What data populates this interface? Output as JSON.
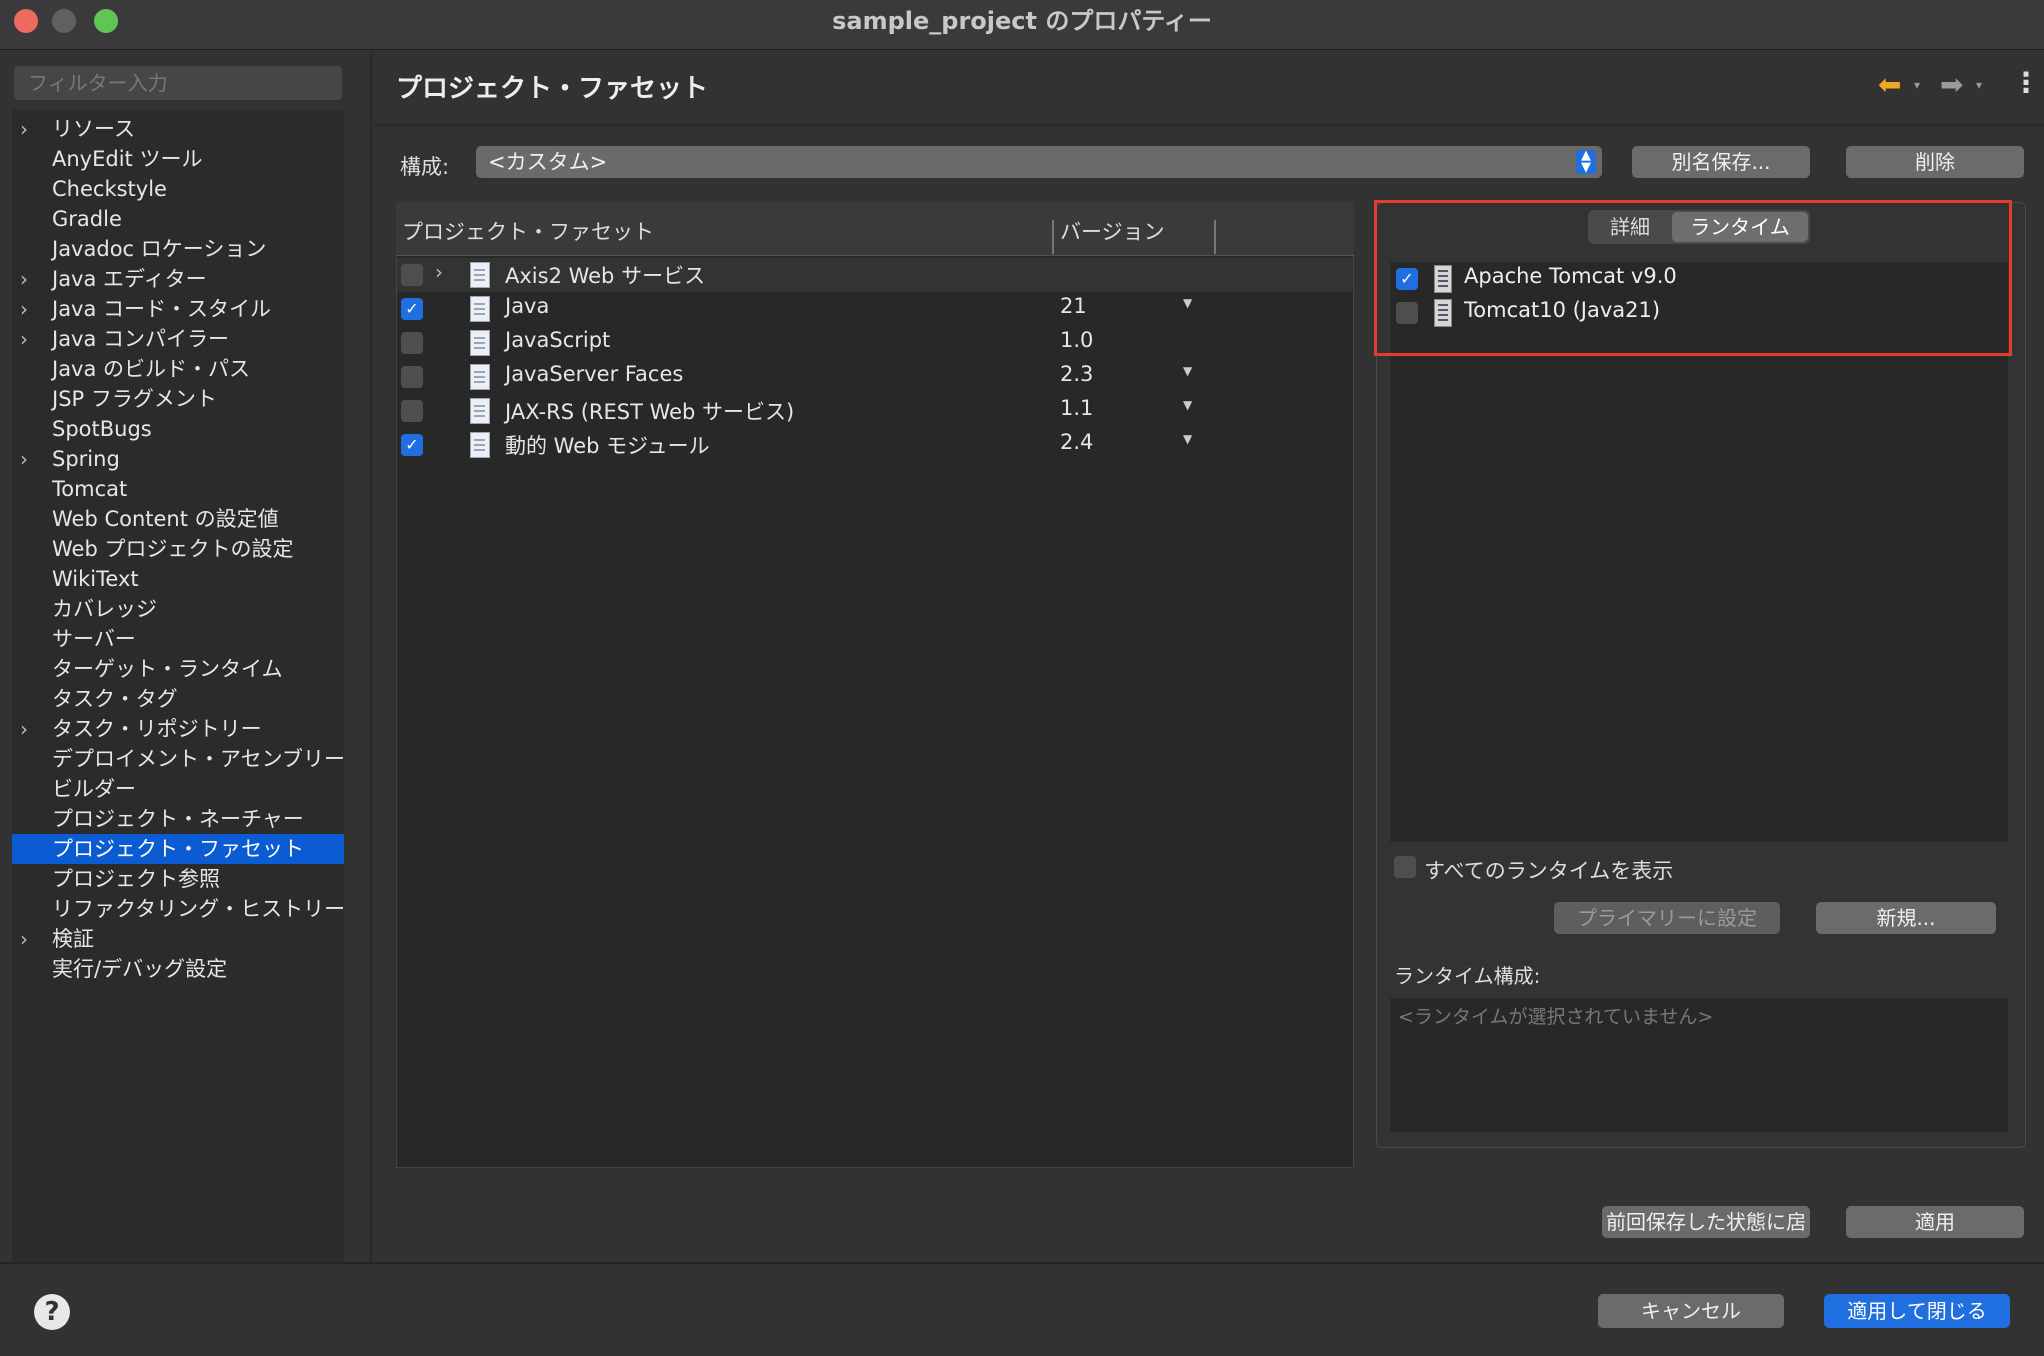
{
  "window": {
    "title": "sample_project のプロパティー"
  },
  "filter": {
    "placeholder": "フィルター入力"
  },
  "sidebar": {
    "items": [
      {
        "label": "リソース",
        "expandable": true
      },
      {
        "label": "AnyEdit ツール",
        "expandable": false
      },
      {
        "label": "Checkstyle",
        "expandable": false
      },
      {
        "label": "Gradle",
        "expandable": false
      },
      {
        "label": "Javadoc ロケーション",
        "expandable": false
      },
      {
        "label": "Java エディター",
        "expandable": true
      },
      {
        "label": "Java コード・スタイル",
        "expandable": true
      },
      {
        "label": "Java コンパイラー",
        "expandable": true
      },
      {
        "label": "Java のビルド・パス",
        "expandable": false
      },
      {
        "label": "JSP フラグメント",
        "expandable": false
      },
      {
        "label": "SpotBugs",
        "expandable": false
      },
      {
        "label": "Spring",
        "expandable": true
      },
      {
        "label": "Tomcat",
        "expandable": false
      },
      {
        "label": "Web Content の設定値",
        "expandable": false
      },
      {
        "label": "Web プロジェクトの設定",
        "expandable": false
      },
      {
        "label": "WikiText",
        "expandable": false
      },
      {
        "label": "カバレッジ",
        "expandable": false
      },
      {
        "label": "サーバー",
        "expandable": false
      },
      {
        "label": "ターゲット・ランタイム",
        "expandable": false
      },
      {
        "label": "タスク・タグ",
        "expandable": false
      },
      {
        "label": "タスク・リポジトリー",
        "expandable": true
      },
      {
        "label": "デプロイメント・アセンブリー",
        "expandable": false
      },
      {
        "label": "ビルダー",
        "expandable": false
      },
      {
        "label": "プロジェクト・ネーチャー",
        "expandable": false
      },
      {
        "label": "プロジェクト・ファセット",
        "expandable": false,
        "selected": true
      },
      {
        "label": "プロジェクト参照",
        "expandable": false
      },
      {
        "label": "リファクタリング・ヒストリー",
        "expandable": false
      },
      {
        "label": "検証",
        "expandable": true
      },
      {
        "label": "実行/デバッグ設定",
        "expandable": false
      }
    ]
  },
  "main": {
    "title": "プロジェクト・ファセット",
    "config_label": "構成:",
    "config_value": "<カスタム>",
    "save_as_button": "別名保存...",
    "delete_button": "削除",
    "facet_table": {
      "col_facet": "プロジェクト・ファセット",
      "col_version": "バージョン",
      "rows": [
        {
          "name": "Axis2 Web サービス",
          "version": "",
          "checked": false,
          "expandable": true,
          "has_dropdown": false,
          "icon": "document-icon"
        },
        {
          "name": "Java",
          "version": "21",
          "checked": true,
          "expandable": false,
          "has_dropdown": true,
          "icon": "java-facet-icon"
        },
        {
          "name": "JavaScript",
          "version": "1.0",
          "checked": false,
          "expandable": false,
          "has_dropdown": false,
          "icon": "document-icon"
        },
        {
          "name": "JavaServer Faces",
          "version": "2.3",
          "checked": false,
          "expandable": false,
          "has_dropdown": true,
          "icon": "document-icon"
        },
        {
          "name": "JAX-RS (REST Web サービス)",
          "version": "1.1",
          "checked": false,
          "expandable": false,
          "has_dropdown": true,
          "icon": "document-icon"
        },
        {
          "name": "動的 Web モジュール",
          "version": "2.4",
          "checked": true,
          "expandable": false,
          "has_dropdown": true,
          "icon": "web-module-icon"
        }
      ]
    },
    "right_panel": {
      "tab_detail": "詳細",
      "tab_runtime": "ランタイム",
      "runtimes": [
        {
          "name": "Apache Tomcat v9.0",
          "checked": true
        },
        {
          "name": "Tomcat10 (Java21)",
          "checked": false
        }
      ],
      "show_all_label": "すべてのランタイムを表示",
      "set_primary_button": "プライマリーに設定",
      "new_button": "新規...",
      "runtime_config_label": "ランタイム構成:",
      "runtime_config_placeholder": "<ランタイムが選択されていません>"
    },
    "restore_button": "前回保存した状態に扂",
    "apply_button": "適用"
  },
  "footer": {
    "cancel_button": "キャンセル",
    "apply_close_button": "適用して閉じる"
  },
  "colors": {
    "accent": "#1f6fe0",
    "selection": "#0b5bd3",
    "highlight_box": "#e23b30",
    "close": "#ed6a5e",
    "minimize": "#f5bf4f",
    "maximize": "#61c554"
  }
}
